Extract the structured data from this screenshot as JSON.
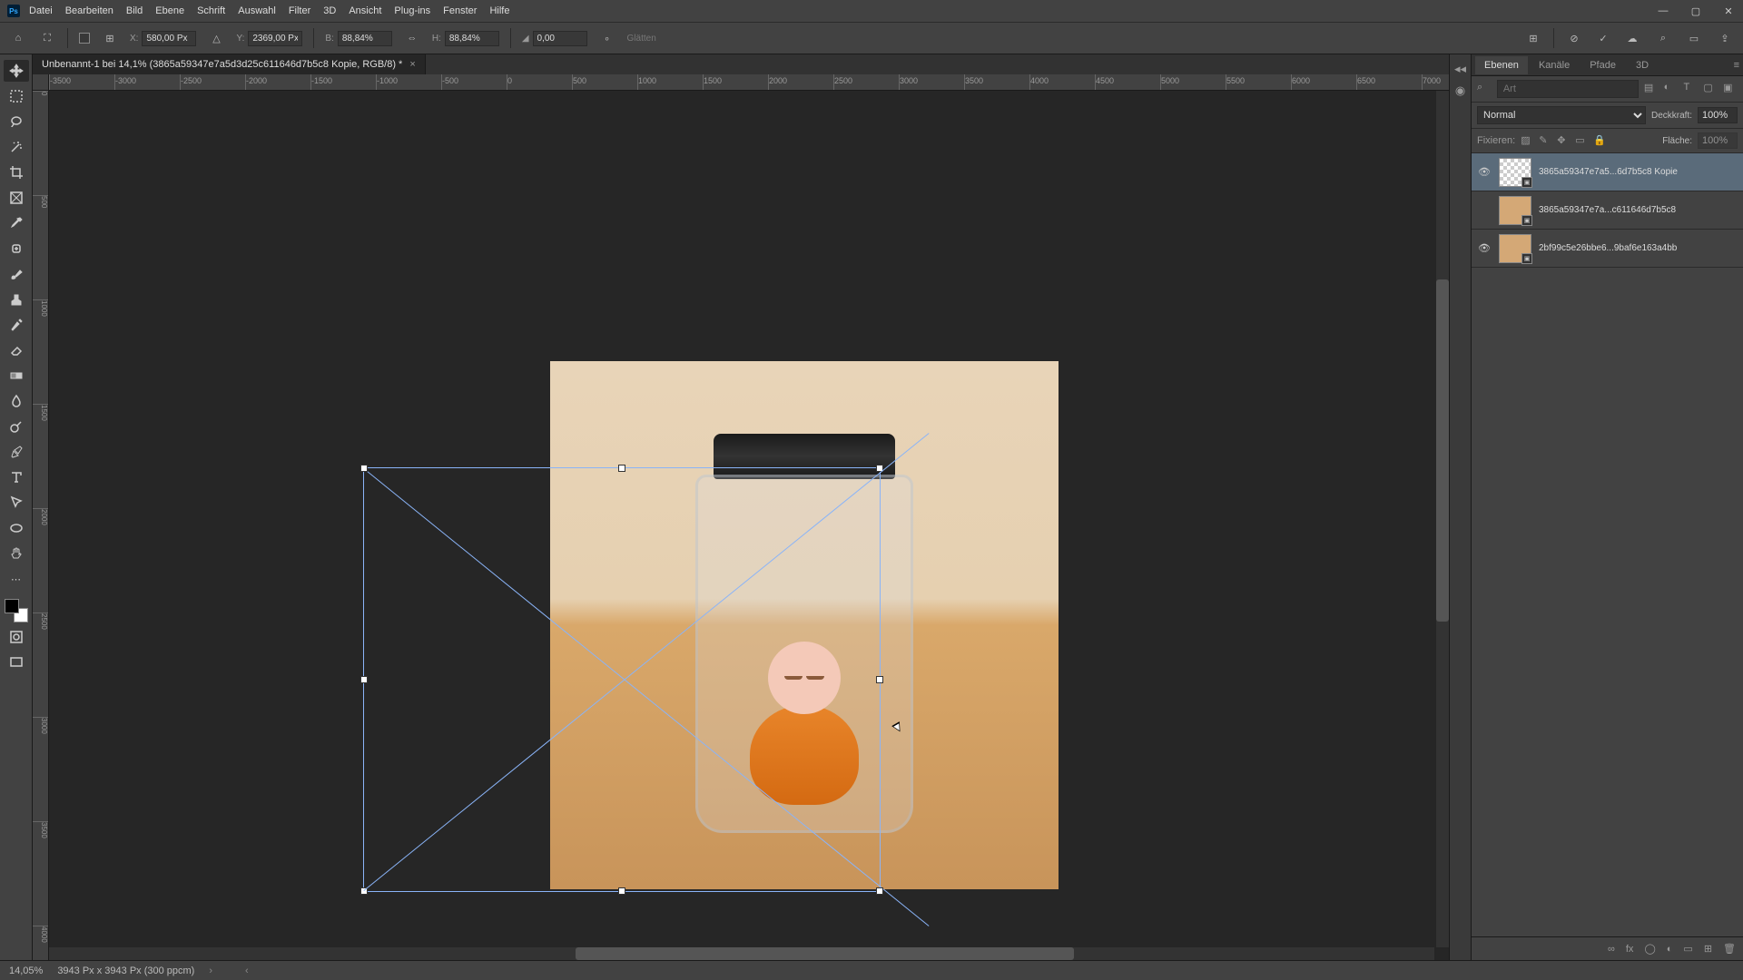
{
  "app": {
    "logo": "Ps"
  },
  "menu": [
    "Datei",
    "Bearbeiten",
    "Bild",
    "Ebene",
    "Schrift",
    "Auswahl",
    "Filter",
    "3D",
    "Ansicht",
    "Plug-ins",
    "Fenster",
    "Hilfe"
  ],
  "optbar": {
    "x_lbl": "X:",
    "x": "580,00 Px",
    "y_lbl": "Y:",
    "y": "2369,00 Px",
    "w_lbl": "B:",
    "w": "88,84%",
    "h_lbl": "H:",
    "h": "88,84%",
    "rot_lbl": "◢",
    "rot": "0,00",
    "interp": "Glätten"
  },
  "doc": {
    "title": "Unbenannt-1 bei 14,1% (3865a59347e7a5d3d25c611646d7b5c8 Kopie, RGB/8) *"
  },
  "ruler_h": [
    "-3500",
    "-3000",
    "-2500",
    "-2000",
    "-1500",
    "-1000",
    "-500",
    "0",
    "500",
    "1000",
    "1500",
    "2000",
    "2500",
    "3000",
    "3500",
    "4000",
    "4500",
    "5000",
    "5500",
    "6000",
    "6500",
    "7000"
  ],
  "ruler_v": [
    "0",
    "500",
    "1000",
    "1500",
    "2000",
    "2500",
    "3000",
    "3500",
    "4000"
  ],
  "panels": {
    "tabs": [
      "Ebenen",
      "Kanäle",
      "Pfade",
      "3D"
    ],
    "search_placeholder": "Art",
    "blend": "Normal",
    "opacity_lbl": "Deckkraft:",
    "opacity": "100%",
    "lock_lbl": "Fixieren:",
    "fill_lbl": "Fläche:",
    "fill": "100%",
    "layers": [
      {
        "name": "3865a59347e7a5...6d7b5c8 Kopie",
        "visible": true,
        "selected": true
      },
      {
        "name": "3865a59347e7a...c611646d7b5c8",
        "visible": false,
        "selected": false
      },
      {
        "name": "2bf99c5e26bbe6...9baf6e163a4bb",
        "visible": true,
        "selected": false
      }
    ]
  },
  "status": {
    "zoom": "14,05%",
    "info": "3943 Px x 3943 Px (300 ppcm)"
  }
}
